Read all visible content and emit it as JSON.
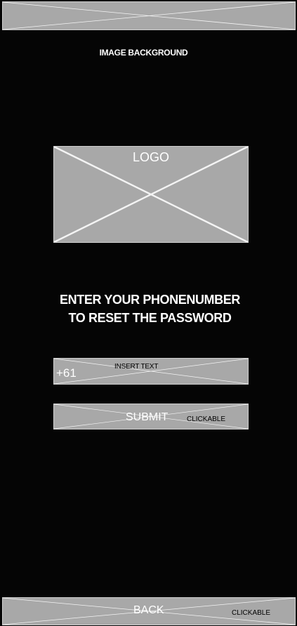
{
  "background_label": "IMAGE BACKGROUND",
  "logo": {
    "label": "LOGO"
  },
  "heading": {
    "line1": "ENTER YOUR PHONENUMBER",
    "line2": "TO RESET THE PASSWORD"
  },
  "phone_input": {
    "country_code": "+61",
    "placeholder": "INSERT TEXT"
  },
  "submit": {
    "label": "SUBMIT",
    "note": "CLICKABLE"
  },
  "back": {
    "label": "BACK",
    "note": "CLICKABLE"
  },
  "colors": {
    "background": "#050505",
    "placeholder_fill": "#a8a8a8",
    "text": "#ffffff"
  }
}
